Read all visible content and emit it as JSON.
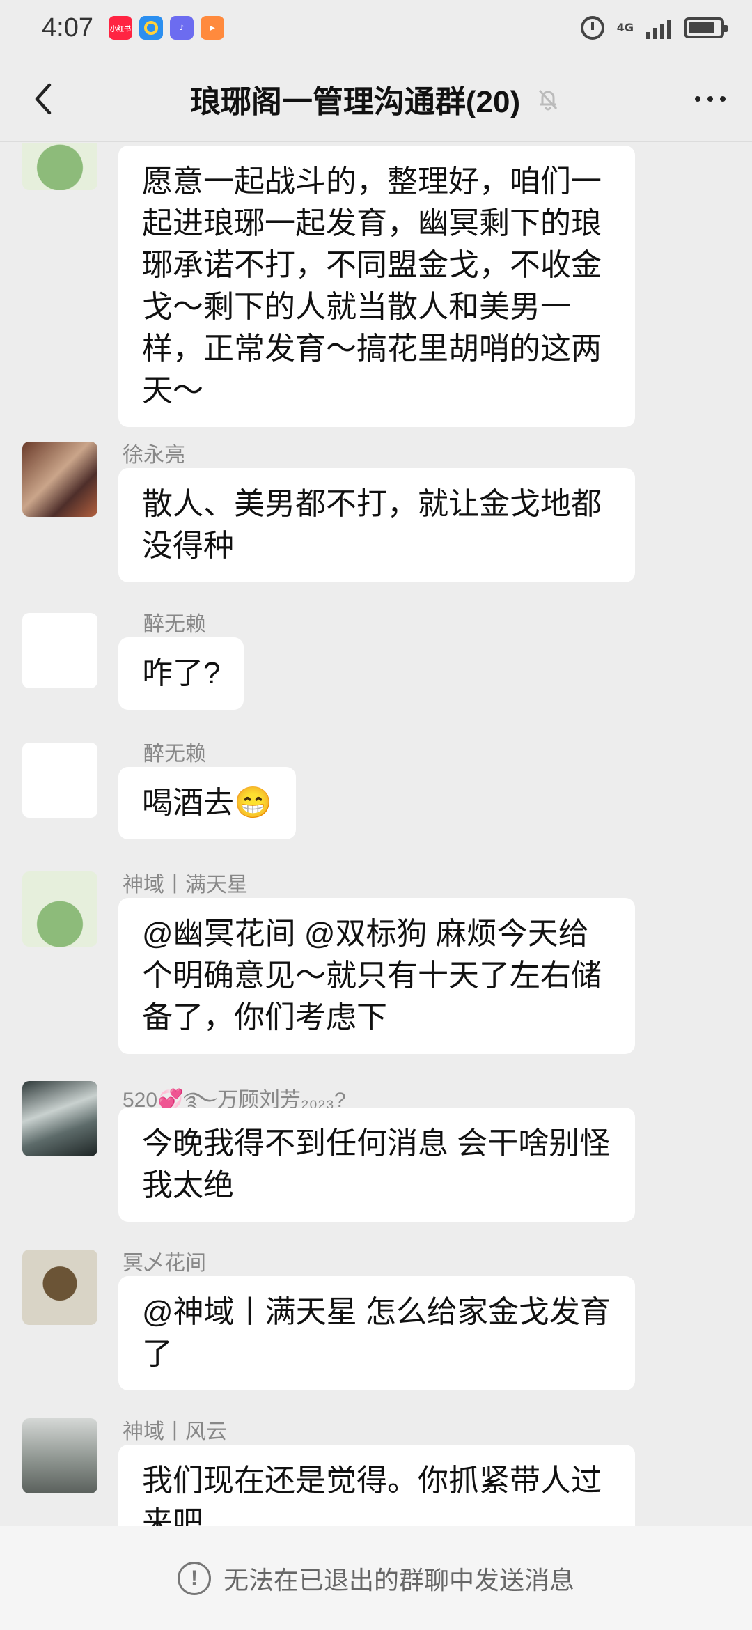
{
  "status_bar": {
    "time": "4:07",
    "apps": [
      {
        "icon": "xiaohongshu-icon",
        "label": "小红书",
        "color": "#ff2442"
      },
      {
        "icon": "app-b-icon",
        "label": "",
        "color": "#2b8ff0"
      },
      {
        "icon": "music-icon",
        "label": "♪",
        "color": "#6c6cf0"
      },
      {
        "icon": "video-icon",
        "label": "▶",
        "color": "#ff8a3d"
      }
    ],
    "network": "4G",
    "battery_level": 0.85
  },
  "header": {
    "title": "琅琊阁一管理沟通群(20)",
    "muted": true
  },
  "messages": [
    {
      "sender": "",
      "text": "愿意一起战斗的，整理好，咱们一起进琅琊一起发育，幽冥剩下的琅琊承诺不打，不同盟金戈，不收金戈～剩下的人就当散人和美男一样，正常发育～搞花里胡哨的这两天～"
    },
    {
      "sender": "徐永亮",
      "text": "散人、美男都不打，就让金戈地都没得种"
    },
    {
      "sender": "醉无赖",
      "text": "咋了?"
    },
    {
      "sender": "醉无赖",
      "text": "喝酒去😁"
    },
    {
      "sender": "神域丨满天星",
      "text": "@幽冥花间  @双标狗   麻烦今天给个明确意见～就只有十天了左右储备了，你们考虑下"
    },
    {
      "sender": "520💞࿐万顾刘芳₂₀₂₃?",
      "text": "今晚我得不到任何消息  会干啥别怪我太绝"
    },
    {
      "sender": "冥乄花间",
      "text": "@神域丨满天星   怎么给家金戈发育了"
    },
    {
      "sender": "神域丨风云",
      "text": "我们现在还是觉得。你抓紧带人过来吧"
    }
  ],
  "footer": {
    "notice": "无法在已退出的群聊中发送消息"
  },
  "colors": {
    "background": "#ededed",
    "bubble": "#ffffff",
    "sender_text": "#888888"
  }
}
